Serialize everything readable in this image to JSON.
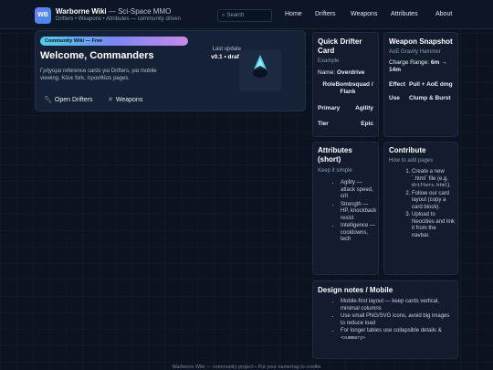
{
  "header": {
    "logo": "WB",
    "title": "Warborne Wiki",
    "title_tag": "— Sci-Space MMO",
    "subtitle": "Drifters • Weapons • Attributes — community driven",
    "search_placeholder": "Search",
    "nav": [
      "Home",
      "Drifters",
      "Weapons",
      "Attributes",
      "About"
    ]
  },
  "hero": {
    "badge": "Community Wiki — Free",
    "title": "Welcome, Commanders",
    "text": "Γρήγορα reference cards για Drifters, για mobile viewing. Κάνε fork, προσθέσε pages.",
    "update_label": "Last update",
    "update_value": "v0.1 • draft",
    "btn_drifters": "Open Drifters",
    "btn_weapons": "Weapons"
  },
  "drifter_card": {
    "title": "Quick Drifter Card",
    "subtitle": "Example",
    "name_label": "Name:",
    "name_value": "Overdrive",
    "role_label": "Role",
    "role_value": "Bombsquad / Flank",
    "primary_label": "Primary",
    "primary_value": "Agility",
    "tier_label": "Tier",
    "tier_value": "Epic"
  },
  "weapon_card": {
    "title": "Weapon Snapshot",
    "subtitle": "AoE Gravity Hammer",
    "charge_label": "Charge Range:",
    "charge_value": "6m → 14m",
    "effect_label": "Effect",
    "effect_value": "Pull + AoE dmg",
    "use_label": "Use",
    "use_value": "Clump & Burst"
  },
  "attributes": {
    "title": "Attributes (short)",
    "subtitle": "Keep it simple",
    "items": [
      "Agility — attack speed, crit",
      "Strength — HP, knockback resist",
      "Intelligence — cooldowns, tech"
    ]
  },
  "contribute": {
    "title": "Contribute",
    "subtitle": "How to add pages",
    "step1_a": "Create a new `.html` file (e.g.",
    "step1_code": "drifters.html",
    "step1_b": ").",
    "step2": "Follow our card layout (copy a card block).",
    "step3": "Upload to Neocities and link it from the navbar."
  },
  "design": {
    "title": "Design notes / Mobile",
    "items": [
      "Mobile-first layout — keep cards vertical, minimal columns",
      "Use small PNG/SVG icons, avoid big images to reduce load"
    ],
    "item3_text": "For longer tables use collapsible details &",
    "item3_code": "<summary>"
  },
  "footer": "Warborne Wiki — community project • Put your namertag to credits",
  "colors": {
    "background": "#0b1220",
    "card": "#121c2e",
    "accent": "#4fd0ea"
  }
}
